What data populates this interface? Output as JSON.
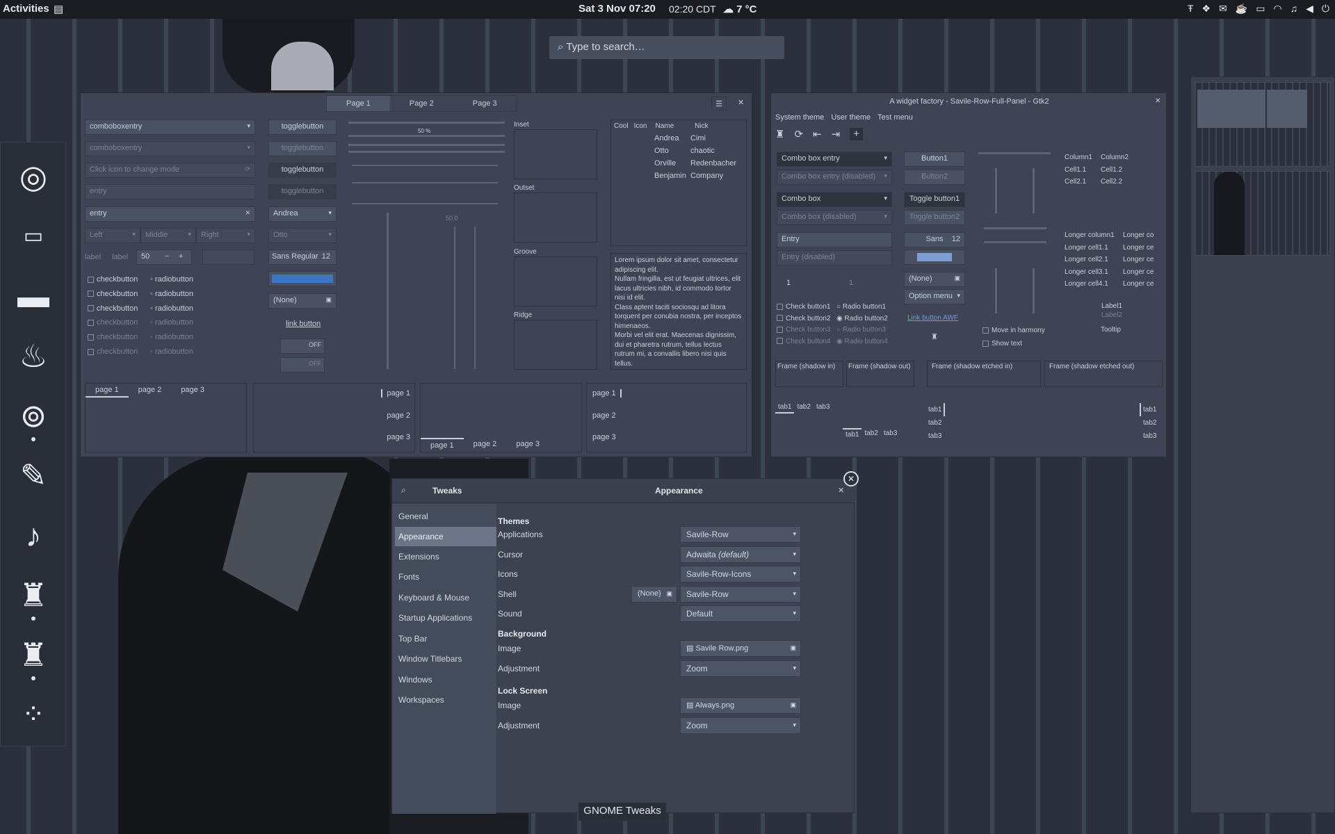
{
  "topbar": {
    "activities": "Activities",
    "clock": "Sat 3 Nov  07:20",
    "alt_time": "02:20 CDT",
    "weather": "7 °C"
  },
  "search": {
    "placeholder": "Type to search…"
  },
  "dock": {
    "icons": [
      "chrome-icon",
      "terminal-icon",
      "files-icon",
      "lamp-icon",
      "toggle-icon",
      "paint-icon",
      "music-icon",
      "factory-icon",
      "factory2-icon",
      "apps-grid-icon"
    ]
  },
  "twf": {
    "tabs": [
      "Page 1",
      "Page 2",
      "Page 3"
    ],
    "combos": [
      "comboboxentry",
      "comboboxentry",
      "Click icon to change mode",
      "entry",
      "entry"
    ],
    "aligns": [
      "Left",
      "Middle",
      "Right"
    ],
    "label1": "label",
    "label2": "label",
    "spin": "50",
    "toggles": [
      "togglebutton",
      "togglebutton",
      "togglebutton",
      "togglebutton"
    ],
    "andrea": "Andrea",
    "otto": "Otto",
    "font": "Sans Regular",
    "font_size": "12",
    "none": "(None)",
    "link": "link button",
    "off1": "OFF",
    "off2": "OFF",
    "checks": [
      "checkbutton",
      "checkbutton",
      "checkbutton",
      "checkbutton",
      "checkbutton",
      "checkbutton"
    ],
    "radios": [
      "radiobutton",
      "radiobutton",
      "radiobutton",
      "radiobutton",
      "radiobutton",
      "radiobutton"
    ],
    "progress_pct": "50 %",
    "scale_val": "50.0",
    "frames": [
      "Inset",
      "Outset",
      "Groove",
      "Ridge"
    ],
    "tree_headers": [
      "Cool",
      "Icon",
      "Name",
      "Nick"
    ],
    "tree_rows": [
      {
        "name": "Andrea",
        "nick": "Cimi"
      },
      {
        "name": "Otto",
        "nick": "chaotic"
      },
      {
        "name": "Orville",
        "nick": "Redenbacher"
      },
      {
        "name": "Benjamin",
        "nick": "Company"
      }
    ],
    "lorem": "Lorem ipsum dolor sit amet, consectetur adipiscing elit.\nNullam fringilla, est ut feugiat ultrices, elit lacus ultricies nibh, id commodo tortor nisi id elit.\nClass aptent taciti sociosqu ad litora torquent per conubia nostra, per inceptos himenaeos.\nMorbi vel elit erat. Maecenas dignissim, dui et pharetra rutrum, tellus lectus rutrum mi, a convallis libero nisi quis tellus.",
    "page_tabs": [
      "page 1",
      "page 2",
      "page 3"
    ]
  },
  "gtk2": {
    "title": "A widget factory - Savile-Row-Full-Panel - Gtk2",
    "menu": [
      "System theme",
      "User theme",
      "Test menu"
    ],
    "combo_entry": "Combo box entry",
    "combo_entry_dis": "Combo box entry (disabled)",
    "combo": "Combo box",
    "combo_dis": "Combo box (disabled)",
    "entry": "Entry",
    "entry_dis": "Entry (disabled)",
    "spin1": "1",
    "spin2": "1",
    "checks": [
      "Check button1",
      "Check button2",
      "Check button3",
      "Check button4"
    ],
    "radios": [
      "Radio button1",
      "Radio button2",
      "Radio button3",
      "Radio button4"
    ],
    "button1": "Button1",
    "button2": "Button2",
    "toggle1": "Toggle button1",
    "toggle2": "Toggle button2",
    "font": "Sans",
    "font_size": "12",
    "none": "(None)",
    "option_menu": "Option menu",
    "link": "Link button AWF",
    "harmony": "Move in harmony",
    "show_text": "Show text",
    "list_headers": [
      "Column1",
      "Column2"
    ],
    "list_rows": [
      [
        "Cell1.1",
        "Cell1.2"
      ],
      [
        "Cell2.1",
        "Cell2.2"
      ]
    ],
    "long_headers": [
      "Longer column1",
      "Longer co"
    ],
    "long_rows": [
      [
        "Longer cell1.1",
        "Longer ce"
      ],
      [
        "Longer cell2.1",
        "Longer ce"
      ],
      [
        "Longer cell3.1",
        "Longer ce"
      ],
      [
        "Longer cell4.1",
        "Longer ce"
      ]
    ],
    "label1": "Label1",
    "label2": "Label2",
    "tooltip": "Tooltip",
    "frames": [
      "Frame (shadow in)",
      "Frame (shadow out)",
      "Frame (shadow etched in)",
      "Frame (shadow etched out)"
    ],
    "tabs": [
      "tab1",
      "tab2",
      "tab3"
    ]
  },
  "tweaks": {
    "app": "Tweaks",
    "title": "Appearance",
    "sidebar": [
      "General",
      "Appearance",
      "Extensions",
      "Fonts",
      "Keyboard & Mouse",
      "Startup Applications",
      "Top Bar",
      "Window Titlebars",
      "Windows",
      "Workspaces"
    ],
    "themes_header": "Themes",
    "applications": "Applications",
    "applications_val": "Savile-Row",
    "cursor": "Cursor",
    "cursor_val": "Adwaita",
    "cursor_default": "(default)",
    "icons": "Icons",
    "icons_val": "Savile-Row-Icons",
    "shell": "Shell",
    "shell_none": "(None)",
    "shell_val": "Savile-Row",
    "sound": "Sound",
    "sound_val": "Default",
    "background_header": "Background",
    "bg_image": "Image",
    "bg_image_val": "Savile Row.png",
    "bg_adjust": "Adjustment",
    "bg_adjust_val": "Zoom",
    "lock_header": "Lock Screen",
    "lock_image": "Image",
    "lock_image_val": "Always.png",
    "lock_adjust": "Adjustment",
    "lock_adjust_val": "Zoom"
  },
  "caption": "GNOME Tweaks"
}
